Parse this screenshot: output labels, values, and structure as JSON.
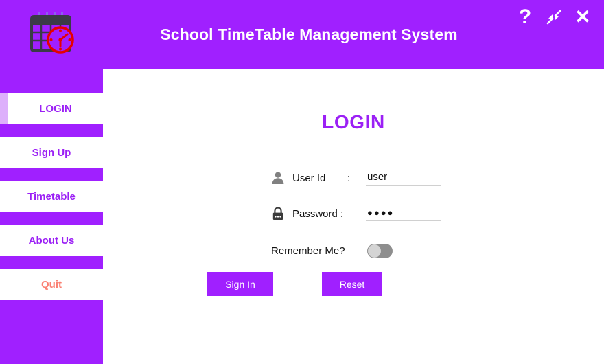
{
  "header": {
    "title": "School TimeTable Management System",
    "logo_icon": "calendar-clock-icon",
    "controls": [
      {
        "name": "help-button",
        "glyph": "?"
      },
      {
        "name": "minimize-button",
        "glyph": "minimize-arrows-icon"
      },
      {
        "name": "close-button",
        "glyph": "✕"
      }
    ]
  },
  "sidebar": {
    "items": [
      {
        "label": "LOGIN",
        "active": true
      },
      {
        "label": "Sign Up",
        "active": false
      },
      {
        "label": "Timetable",
        "active": false
      },
      {
        "label": "About Us",
        "active": false
      },
      {
        "label": "Quit",
        "active": false
      }
    ]
  },
  "main": {
    "page_title": "LOGIN",
    "fields": {
      "user_id": {
        "icon": "user-icon",
        "label": "User Id",
        "separator": ":",
        "value": "user",
        "placeholder": ""
      },
      "password": {
        "icon": "lock-icon",
        "label": "Password :",
        "separator": "",
        "value": "●●●●",
        "placeholder": ""
      }
    },
    "remember_me": {
      "label": "Remember Me?",
      "checked": false
    },
    "buttons": {
      "sign_in": "Sign In",
      "reset": "Reset"
    }
  },
  "colors": {
    "purple": "#a020ff",
    "purple_text": "#9b20f5",
    "active_indicator": "#ddb0fb",
    "quit_text": "#fa8072",
    "toggle_track": "#8e8e8e",
    "toggle_knob": "#d4d4d4"
  }
}
